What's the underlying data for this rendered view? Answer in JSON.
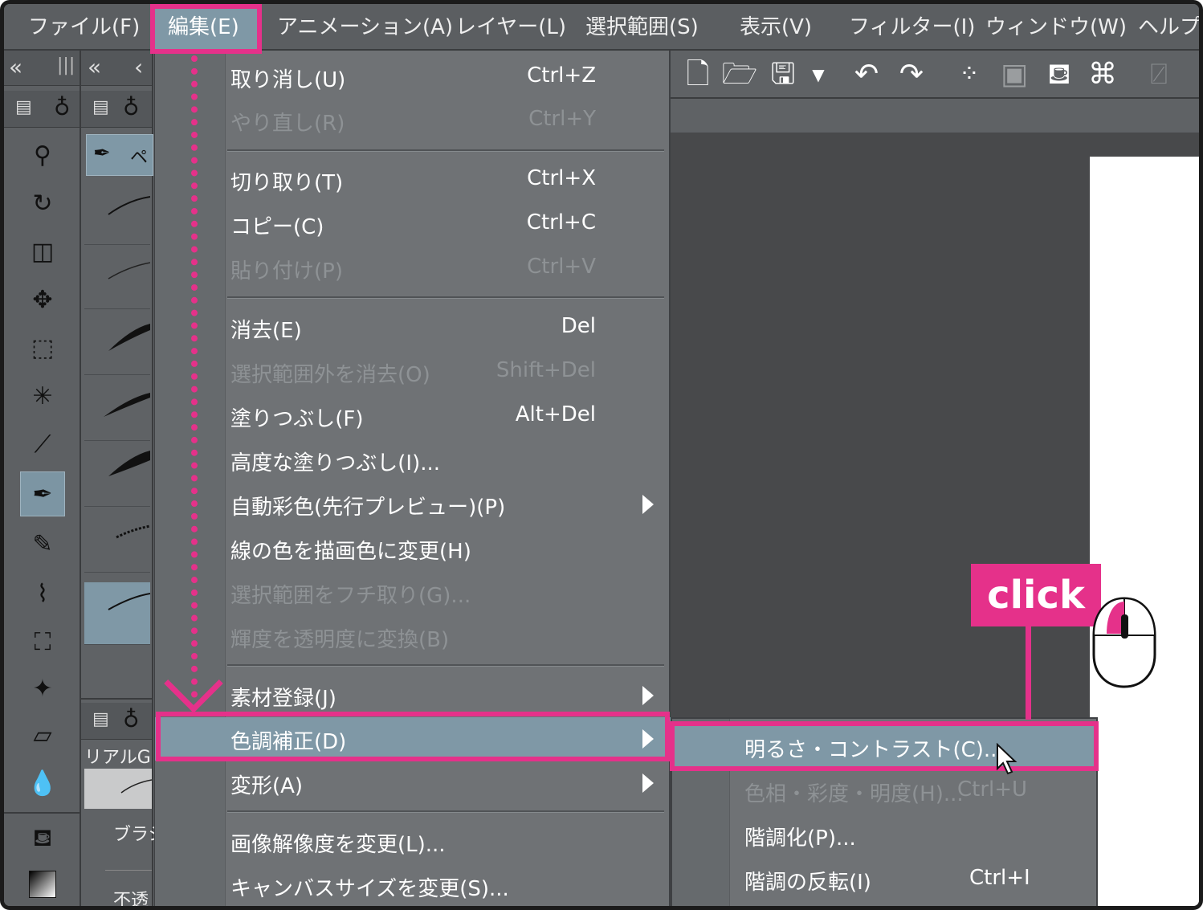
{
  "menubar": {
    "items": [
      "ファイル(F)",
      "編集(E)",
      "アニメーション(A)",
      "レイヤー(L)",
      "選択範囲(S)",
      "表示(V)",
      "フィルター(I)",
      "ウィンドウ(W)",
      "ヘルプ(H)"
    ]
  },
  "edit_menu": {
    "items": [
      {
        "label": "取り消し(U)",
        "shortcut": "Ctrl+Z",
        "enabled": true
      },
      {
        "label": "やり直し(R)",
        "shortcut": "Ctrl+Y",
        "enabled": false
      },
      {
        "label": "切り取り(T)",
        "shortcut": "Ctrl+X",
        "enabled": true
      },
      {
        "label": "コピー(C)",
        "shortcut": "Ctrl+C",
        "enabled": true
      },
      {
        "label": "貼り付け(P)",
        "shortcut": "Ctrl+V",
        "enabled": false
      },
      {
        "label": "消去(E)",
        "shortcut": "Del",
        "enabled": true
      },
      {
        "label": "選択範囲外を消去(O)",
        "shortcut": "Shift+Del",
        "enabled": false
      },
      {
        "label": "塗りつぶし(F)",
        "shortcut": "Alt+Del",
        "enabled": true
      },
      {
        "label": "高度な塗りつぶし(I)...",
        "shortcut": "",
        "enabled": true
      },
      {
        "label": "自動彩色(先行プレビュー)(P)",
        "shortcut": "",
        "enabled": true,
        "submenu": true
      },
      {
        "label": "線の色を描画色に変更(H)",
        "shortcut": "",
        "enabled": true
      },
      {
        "label": "選択範囲をフチ取り(G)...",
        "shortcut": "",
        "enabled": false
      },
      {
        "label": "輝度を透明度に変換(B)",
        "shortcut": "",
        "enabled": false
      },
      {
        "label": "素材登録(J)",
        "shortcut": "",
        "enabled": true,
        "submenu": true
      },
      {
        "label": "色調補正(D)",
        "shortcut": "",
        "enabled": true,
        "submenu": true,
        "highlighted": true
      },
      {
        "label": "変形(A)",
        "shortcut": "",
        "enabled": true,
        "submenu": true
      },
      {
        "label": "画像解像度を変更(L)...",
        "shortcut": "",
        "enabled": true
      },
      {
        "label": "キャンバスサイズを変更(S)...",
        "shortcut": "",
        "enabled": true
      }
    ]
  },
  "tonal_submenu": {
    "items": [
      {
        "label": "明るさ・コントラスト(C)...",
        "shortcut": "",
        "enabled": true,
        "highlighted": true
      },
      {
        "label": "色相・彩度・明度(H)...",
        "shortcut": "Ctrl+U",
        "enabled": false
      },
      {
        "label": "階調化(P)...",
        "shortcut": "",
        "enabled": true
      },
      {
        "label": "階調の反転(I)",
        "shortcut": "Ctrl+I",
        "enabled": true
      }
    ]
  },
  "sub_tool_panel": {
    "tab_label": "ペ",
    "group_label": "リアルG",
    "brush_size_label": "ブラシ",
    "opacity_label": "不透"
  },
  "annotation": {
    "click_label": "click",
    "accent_color": "#e5318a"
  }
}
